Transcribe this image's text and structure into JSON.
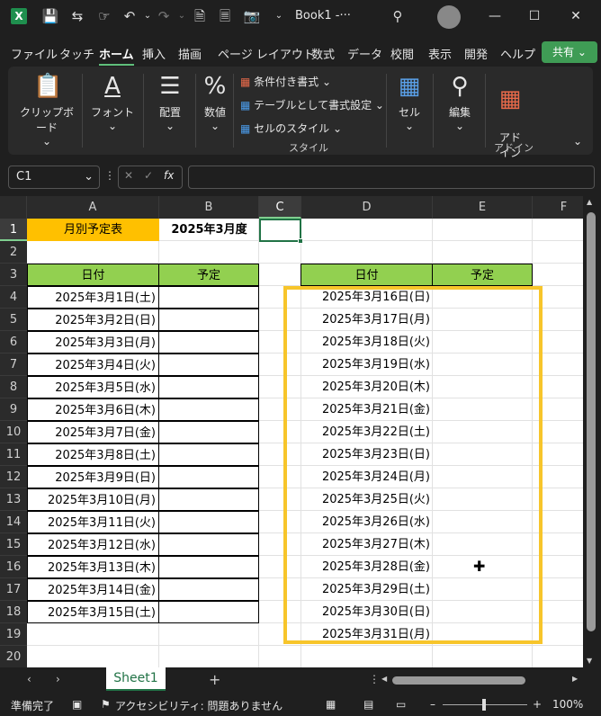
{
  "titlebar": {
    "logo": "X",
    "title": "Book1 -···",
    "icons": [
      "save-icon",
      "autosave-icon",
      "touch-mode-icon",
      "undo-icon",
      "redo-icon",
      "file-icon",
      "file2-icon",
      "camera-icon",
      "search-icon"
    ],
    "minimize": "—",
    "maximize": "☐",
    "close": "✕"
  },
  "menu": {
    "items": [
      "ファイル",
      "タッチ",
      "ホーム",
      "挿入",
      "描画",
      "ページ レイアウト",
      "数式",
      "データ",
      "校閲",
      "表示",
      "開発",
      "ヘルプ"
    ],
    "share": "共有"
  },
  "ribbon": {
    "clipboard": "クリップボード",
    "font": "フォント",
    "alignment": "配置",
    "number": "数値",
    "cond_format": "条件付き書式",
    "table_format": "テーブルとして書式設定",
    "cell_styles": "セルのスタイル",
    "styles_group": "スタイル",
    "cells": "セル",
    "editing": "編集",
    "addins": "アド\nイン",
    "addins_group": "アドイン"
  },
  "formula_bar": {
    "namebox": "C1",
    "fx": "fx",
    "formula": ""
  },
  "sheet": {
    "columns": [
      "A",
      "B",
      "C",
      "D",
      "E",
      "F"
    ],
    "rows": [
      "1",
      "2",
      "3",
      "4",
      "5",
      "6",
      "7",
      "8",
      "9",
      "10",
      "11",
      "12",
      "13",
      "14",
      "15",
      "16",
      "17",
      "18",
      "19",
      "20"
    ],
    "title_cell": "月別予定表",
    "month_cell": "2025年3月度",
    "header_date": "日付",
    "header_plan": "予定",
    "left_dates": [
      "2025年3月1日(土)",
      "2025年3月2日(日)",
      "2025年3月3日(月)",
      "2025年3月4日(火)",
      "2025年3月5日(水)",
      "2025年3月6日(木)",
      "2025年3月7日(金)",
      "2025年3月8日(土)",
      "2025年3月9日(日)",
      "2025年3月10日(月)",
      "2025年3月11日(火)",
      "2025年3月12日(水)",
      "2025年3月13日(木)",
      "2025年3月14日(金)",
      "2025年3月15日(土)"
    ],
    "right_dates": [
      "2025年3月16日(日)",
      "2025年3月17日(月)",
      "2025年3月18日(火)",
      "2025年3月19日(水)",
      "2025年3月20日(木)",
      "2025年3月21日(金)",
      "2025年3月22日(土)",
      "2025年3月23日(日)",
      "2025年3月24日(月)",
      "2025年3月25日(火)",
      "2025年3月26日(水)",
      "2025年3月27日(木)",
      "2025年3月28日(金)",
      "2025年3月29日(土)",
      "2025年3月30日(日)",
      "2025年3月31日(月)"
    ],
    "colors": {
      "title_bg": "#ffc000",
      "header_bg": "#92d050",
      "highlight": "#f7c52b"
    }
  },
  "sheetbar": {
    "tab": "Sheet1",
    "add": "+"
  },
  "statusbar": {
    "ready": "準備完了",
    "accessibility": "アクセシビリティ: 問題ありません",
    "zoom": "100%"
  }
}
